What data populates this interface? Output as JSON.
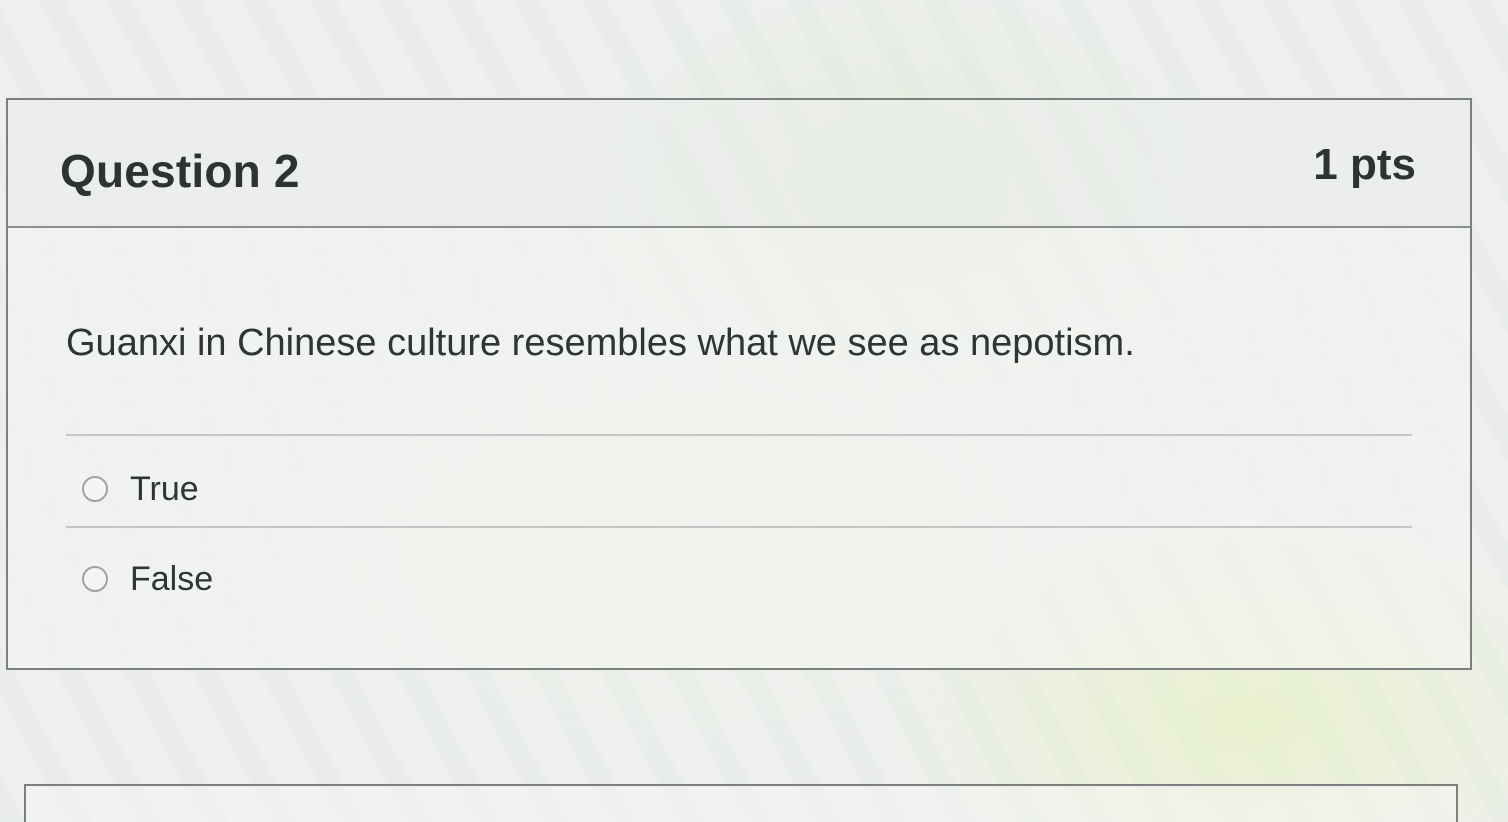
{
  "question": {
    "title": "Question 2",
    "points": "1 pts",
    "text": "Guanxi in Chinese culture resembles what we see as nepotism.",
    "answers": [
      {
        "label": "True",
        "selected": false
      },
      {
        "label": "False",
        "selected": false
      }
    ]
  },
  "colors": {
    "border": "#7b7f7e",
    "text": "#2f3436",
    "divider": "#c3c8c6"
  }
}
